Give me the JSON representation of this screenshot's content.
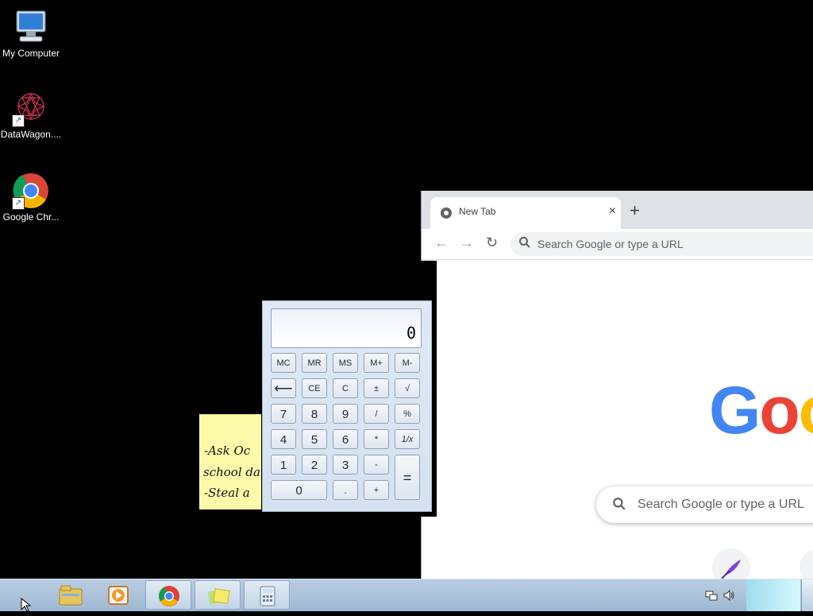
{
  "desktop": {
    "icons": [
      {
        "label": "My Computer",
        "icon": "computer-icon"
      },
      {
        "label": "DataWagon....",
        "icon": "datawagon-icon"
      },
      {
        "label": "Google Chr...",
        "icon": "chrome-icon"
      }
    ]
  },
  "chrome": {
    "tab_title": "New Tab",
    "tab_close": "×",
    "new_tab": "+",
    "back": "←",
    "forward": "→",
    "reload": "↻",
    "omnibox_placeholder": "Search Google or type a URL",
    "ntp_search_placeholder": "Search Google or type a URL",
    "logo_text": "Goo",
    "colors": {
      "blue": "#4285f4",
      "red": "#ea4335",
      "yellow": "#fbbc05"
    }
  },
  "sticky": {
    "lines": [
      "-Ask Oc",
      "school da",
      "-Steal a"
    ]
  },
  "calculator": {
    "display": "0",
    "rows": [
      [
        "MC",
        "MR",
        "MS",
        "M+",
        "M-"
      ],
      [
        "⟵",
        "CE",
        "C",
        "±",
        "√"
      ],
      [
        "7",
        "8",
        "9",
        "/",
        "%"
      ],
      [
        "4",
        "5",
        "6",
        "*",
        "1/x"
      ],
      [
        "1",
        "2",
        "3",
        "-",
        "="
      ],
      [
        "0",
        ".",
        "+"
      ]
    ]
  },
  "taskbar": {
    "items": [
      "file-explorer-icon",
      "media-player-icon",
      "chrome-icon",
      "sticky-notes-icon",
      "calculator-icon"
    ],
    "tray": [
      "network-icon",
      "volume-icon"
    ]
  }
}
